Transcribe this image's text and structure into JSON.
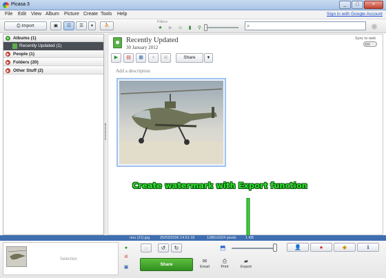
{
  "window": {
    "title": "Picasa 3",
    "min": "_",
    "max": "□",
    "close": "×"
  },
  "menu": {
    "items": [
      "File",
      "Edit",
      "View",
      "Album",
      "Picture",
      "Create",
      "Tools",
      "Help"
    ],
    "signin": "Sign in with Google Account"
  },
  "toolbar": {
    "import_label": "Import",
    "filters_label": "Filters",
    "search_placeholder": ""
  },
  "sidebar": {
    "albums": "Albums (1)",
    "recently_updated": "Recently Updated (1)",
    "people": "People (1)",
    "folders": "Folders (20)",
    "other": "Other Stuff (2)"
  },
  "album": {
    "title": "Recently Updated",
    "date": "30 January 2012",
    "sync_label": "Sync to web",
    "share_label": "Share",
    "add_description": "Add a description"
  },
  "annotation": "Create watermark with Export function",
  "status": {
    "filename": "nou (31).jpg",
    "datetime": "25/03/2036 14:51:16",
    "dimensions": "1280x1024 pixels",
    "size": "1  KB"
  },
  "bottom": {
    "selection_label": "Selection",
    "share_button": "Share",
    "email_label": "Email",
    "print_label": "Print",
    "export_label": "Export"
  },
  "colors": {
    "accent_green": "#2ee22e",
    "status_blue": "#3f6fb0",
    "share_green": "#3fa82a"
  }
}
